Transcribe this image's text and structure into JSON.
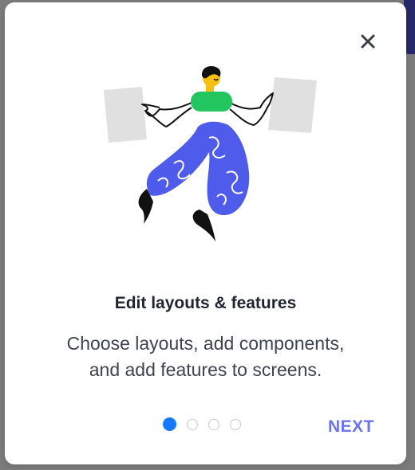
{
  "dialog": {
    "close_icon": "close-icon",
    "illustration": "person-jumping-between-layout-cards",
    "title": "Edit layouts & features",
    "description_line1": "Choose layouts, add components,",
    "description_line2": "and add features to screens.",
    "pagination": {
      "total": 4,
      "active_index": 0
    },
    "next_label": "NEXT"
  },
  "colors": {
    "accent_blue": "#1677ff",
    "next_text": "#6a74f0",
    "shirt_green": "#22c55e",
    "pants_blue": "#4f5bea",
    "skin_yellow": "#f7c010"
  }
}
